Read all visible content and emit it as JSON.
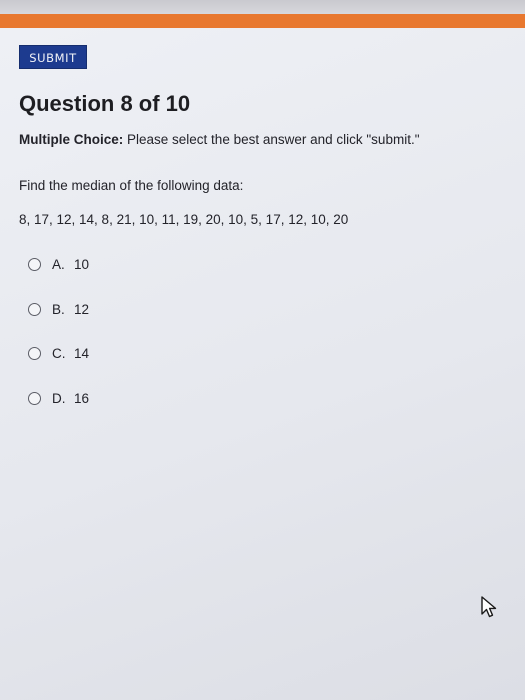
{
  "toolbar": {
    "submit_label": "SUBMIT"
  },
  "question": {
    "title": "Question 8 of 10",
    "instruction_prefix": "Multiple Choice:",
    "instruction_text": "Please select the best answer and click \"submit.\"",
    "prompt": "Find the median of the following data:",
    "dataset": "8, 17, 12, 14, 8, 21, 10, 11, 19, 20, 10, 5, 17, 12, 10, 20"
  },
  "options": [
    {
      "letter": "A.",
      "value": "10"
    },
    {
      "letter": "B.",
      "value": "12"
    },
    {
      "letter": "C.",
      "value": "14"
    },
    {
      "letter": "D.",
      "value": "16"
    }
  ],
  "icons": {
    "cursor": "mouse-pointer-icon"
  },
  "colors": {
    "accent_band": "#e8782f",
    "submit_background": "#1d3b8f"
  }
}
